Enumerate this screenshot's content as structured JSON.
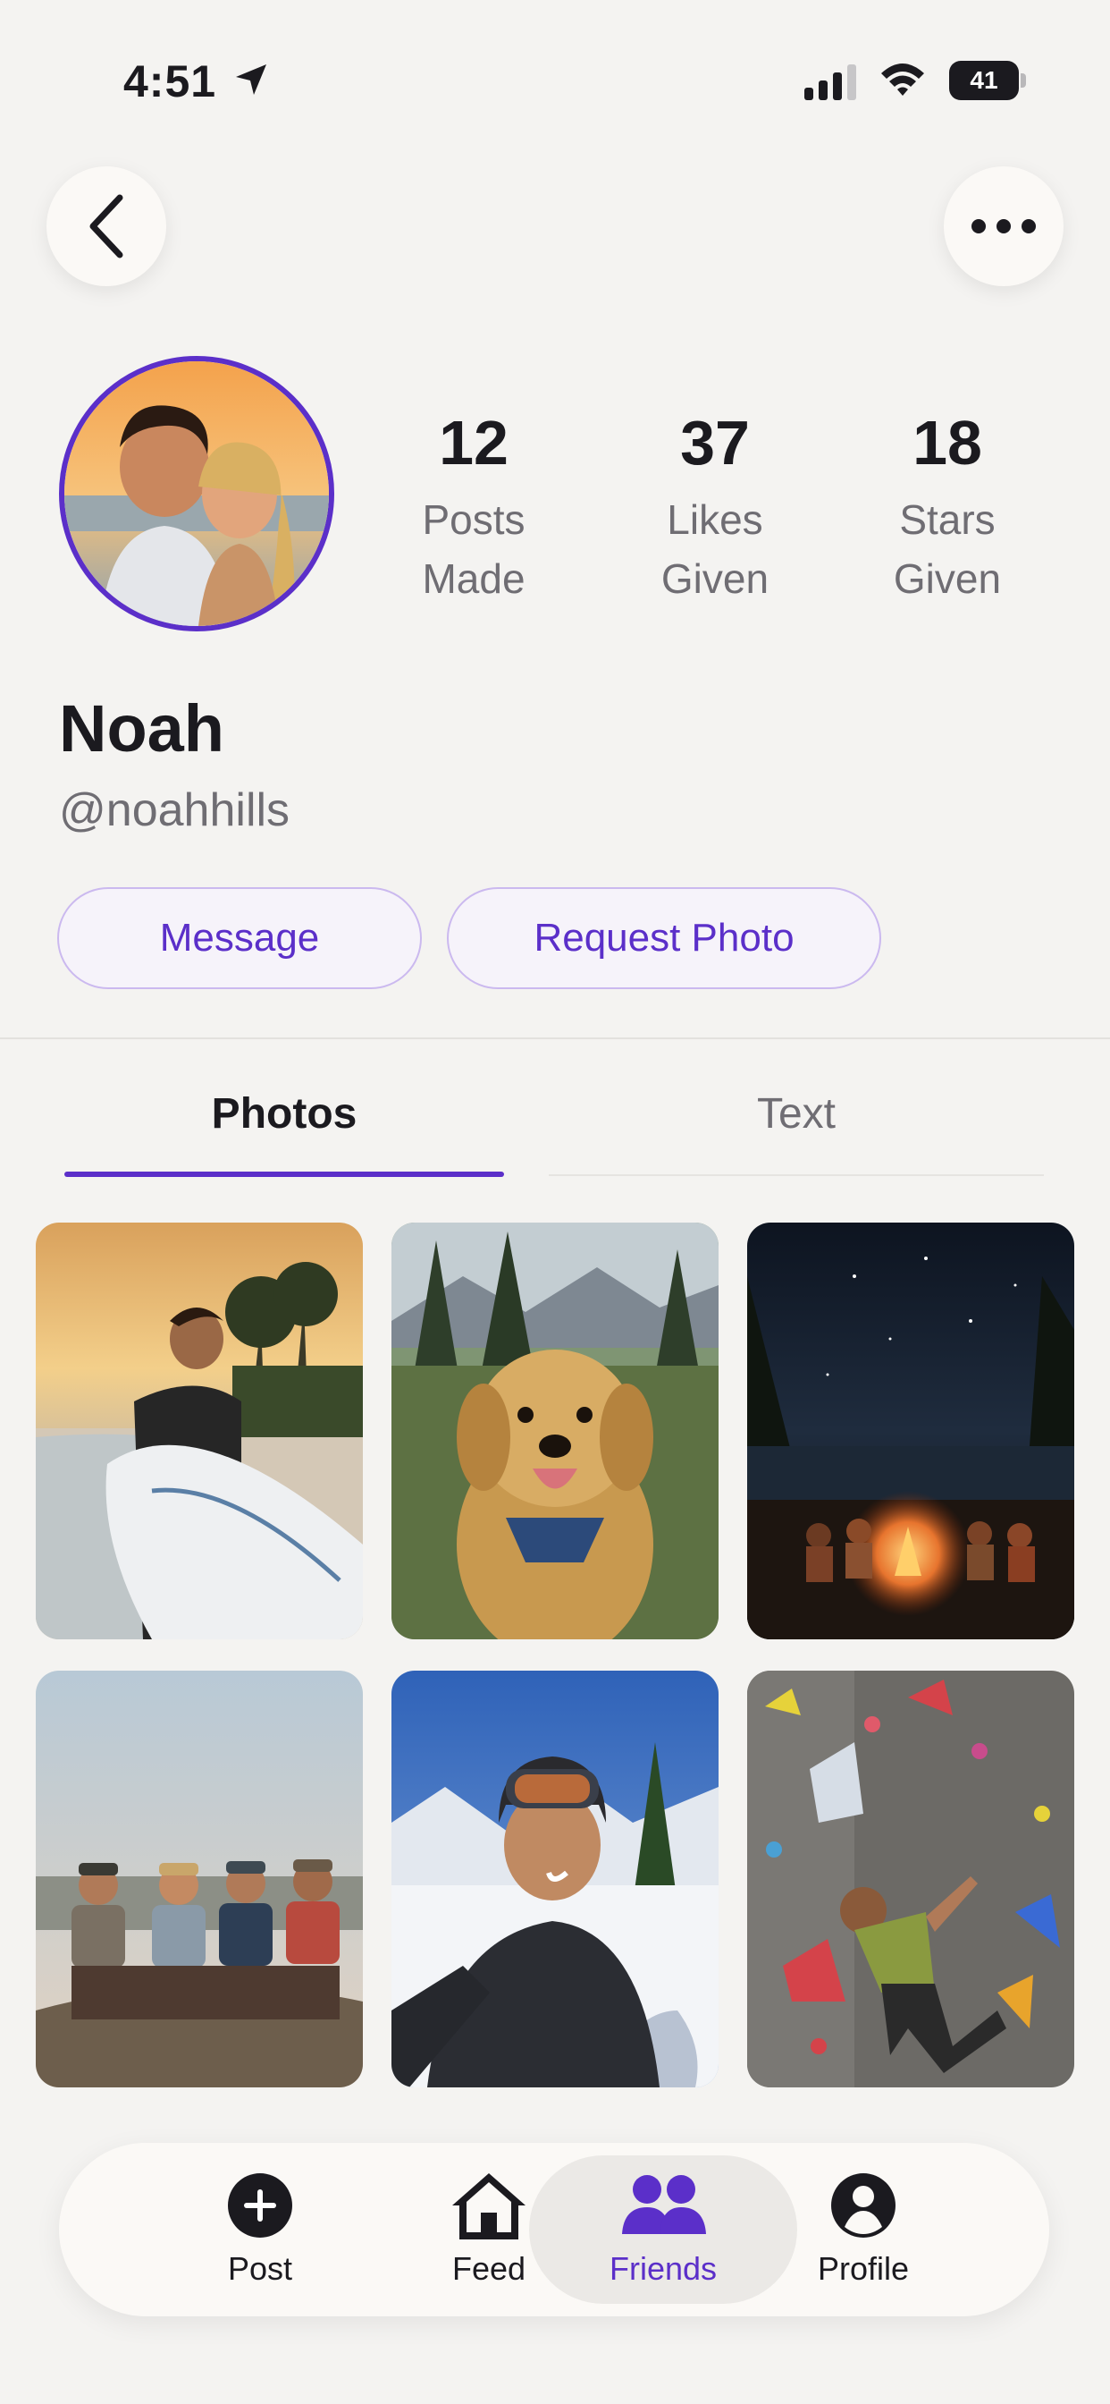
{
  "status_bar": {
    "time": "4:51",
    "battery": "41"
  },
  "profile": {
    "name": "Noah",
    "handle": "@noahhills",
    "stats": [
      {
        "value": "12",
        "label_line1": "Posts",
        "label_line2": "Made"
      },
      {
        "value": "37",
        "label_line1": "Likes",
        "label_line2": "Given"
      },
      {
        "value": "18",
        "label_line1": "Stars",
        "label_line2": "Given"
      }
    ]
  },
  "actions": {
    "message": "Message",
    "request_photo": "Request Photo"
  },
  "tabs": [
    {
      "label": "Photos",
      "active": true
    },
    {
      "label": "Text",
      "active": false
    }
  ],
  "photos": [
    "surfer-on-beach",
    "golden-retriever-on-trail",
    "campfire-under-stars",
    "friends-sitting-on-rock",
    "skier-selfie-in-snow",
    "rock-climbing-wall"
  ],
  "nav": {
    "items": [
      {
        "label": "Post",
        "icon": "plus-circle-icon"
      },
      {
        "label": "Feed",
        "icon": "home-icon"
      },
      {
        "label": "Friends",
        "icon": "friends-icon",
        "active": true
      },
      {
        "label": "Profile",
        "icon": "person-circle-icon"
      }
    ]
  },
  "colors": {
    "accent": "#5b2fc9",
    "background": "#f4f3f1",
    "text_muted": "#6f6d73"
  }
}
